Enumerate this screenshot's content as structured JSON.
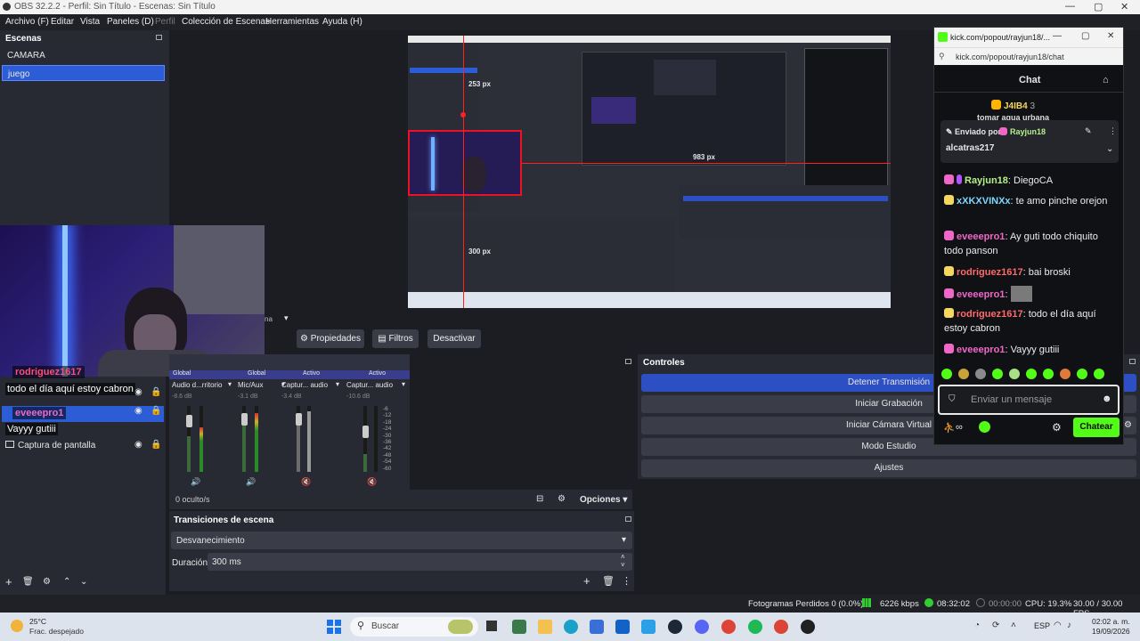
{
  "window": {
    "title": "OBS 32.2.2 - Perfil: Sin Título - Escenas: Sin Título"
  },
  "menu": [
    "Archivo (F)",
    "Editar",
    "Vista",
    "Paneles (D)",
    "Perfil",
    "Colección de Escenas",
    "Herramientas",
    "Ayuda (H)"
  ],
  "scenes": {
    "title": "Escenas",
    "items": [
      "CAMARA",
      "juego"
    ],
    "selected": "juego"
  },
  "preview": {
    "measure_top": "253 px",
    "measure_right": "983 px",
    "measure_bottom": "300 px"
  },
  "sources_toolbar": {
    "properties": "Propiedades",
    "filters": "Filtros",
    "deactivate": "Desactivar"
  },
  "sources": {
    "items": [
      "Captura de pantalla"
    ],
    "overlay_label_partial": "na"
  },
  "overlay_chat": [
    {
      "user": "rodriguez1617",
      "text": "todo el día aquí estoy cabron"
    },
    {
      "user": "eveeepro1",
      "text": "Vayyy gutiii"
    }
  ],
  "mixer": {
    "header": [
      "Global",
      "Global",
      "Activo",
      "Activo"
    ],
    "channels": [
      {
        "name": "Audio d...rritorio",
        "db": "-8.6 dB"
      },
      {
        "name": "Mic/Aux",
        "db": "-3.1 dB"
      },
      {
        "name": "Captur... audio",
        "db": "-3.4 dB"
      },
      {
        "name": "Captur... audio",
        "db": "-10.6 dB"
      }
    ],
    "scale": [
      "-6",
      "-12",
      "-18",
      "-24",
      "-30",
      "-36",
      "-42",
      "-48",
      "-54",
      "-60"
    ]
  },
  "bottom_bar": {
    "hidden_count": "0 oculto/s",
    "options": "Opciones"
  },
  "transitions": {
    "title": "Transiciones de escena",
    "type": "Desvanecimiento",
    "duration_label": "Duración",
    "duration_value": "300 ms"
  },
  "controls": {
    "title": "Controles",
    "buttons": [
      "Detener Transmisión",
      "Iniciar Grabación",
      "Iniciar Cámara Virtual",
      "Modo Estudio",
      "Ajustes"
    ]
  },
  "chat_popup": {
    "url_title": "kick.com/popout/rayjun18/...",
    "address": "kick.com/popout/rayjun18/chat",
    "header": "Chat",
    "pinned_user": "J4IB4",
    "pinned_count": "3",
    "pinned_label": "Enviado por",
    "pinned_by": "Rayjun18",
    "pinned_subtext": "tomar agua urbana",
    "pinned_message": "alcatras217",
    "messages": [
      {
        "user": "Rayjun18",
        "text": "DiegoCA",
        "cls": "u-green"
      },
      {
        "user": "xXKXVINXx",
        "text": "te amo pinche orejon",
        "cls": "u-cyan"
      },
      {
        "user": "eveeepro1",
        "text": "Ay guti todo chiquito todo panson",
        "cls": "u-pink"
      },
      {
        "user": "rodriguez1617",
        "text": "bai broski",
        "cls": "u-red"
      },
      {
        "user": "eveeepro1",
        "text": "",
        "cls": "u-pink"
      },
      {
        "user": "rodriguez1617",
        "text": "todo el día aquí estoy cabron",
        "cls": "u-red"
      },
      {
        "user": "eveeepro1",
        "text": "Vayyy gutiii",
        "cls": "u-pink"
      }
    ],
    "input_placeholder": "Enviar un mensaje",
    "send_button": "Chatear"
  },
  "status": {
    "dropped_frames": "Fotogramas Perdidos 0 (0.0%)",
    "bitrate": "6226 kbps",
    "stream_time": "08:32:02",
    "rec_time": "00:00:00",
    "cpu": "CPU: 19.3%",
    "fps": "30.00 / 30.00 FPS"
  },
  "taskbar": {
    "weather_temp": "25°C",
    "weather_desc": "Frac. despejado",
    "search": "Buscar",
    "lang": "ESP",
    "time": "02:02 a. m.",
    "date": "19/09/2026"
  },
  "colors": {
    "accent": "#2d4fc4",
    "kick_green": "#53fc18",
    "selected_scene": "#2c5cd6"
  }
}
